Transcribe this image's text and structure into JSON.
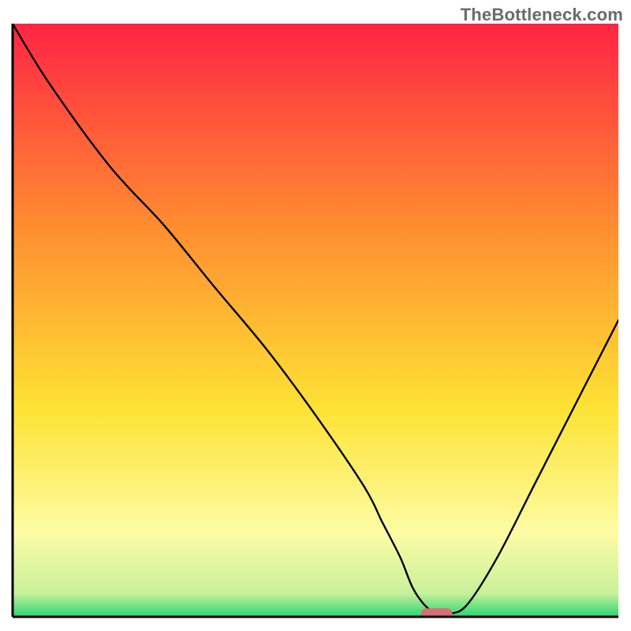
{
  "watermark": "TheBottleneck.com",
  "chart_data": {
    "type": "line",
    "title": "",
    "xlabel": "",
    "ylabel": "",
    "xlim": [
      0,
      100
    ],
    "ylim": [
      0,
      100
    ],
    "x": [
      0,
      6,
      16,
      25,
      33,
      42,
      50,
      58,
      61,
      64,
      66,
      68,
      70,
      72,
      75,
      80,
      86,
      92,
      100
    ],
    "values": [
      100,
      90,
      76,
      66,
      56,
      45,
      34,
      22,
      16,
      10,
      5,
      2,
      0.5,
      0.5,
      2,
      10,
      22,
      34,
      50
    ],
    "marker": {
      "x": 70,
      "y": 0.5,
      "color": "#d86e77"
    },
    "background": {
      "top": "#ff2445",
      "mid_upper": "#ff8f30",
      "mid": "#fde334",
      "lower": "#fdfca5",
      "bottom": "#2bd672"
    }
  }
}
